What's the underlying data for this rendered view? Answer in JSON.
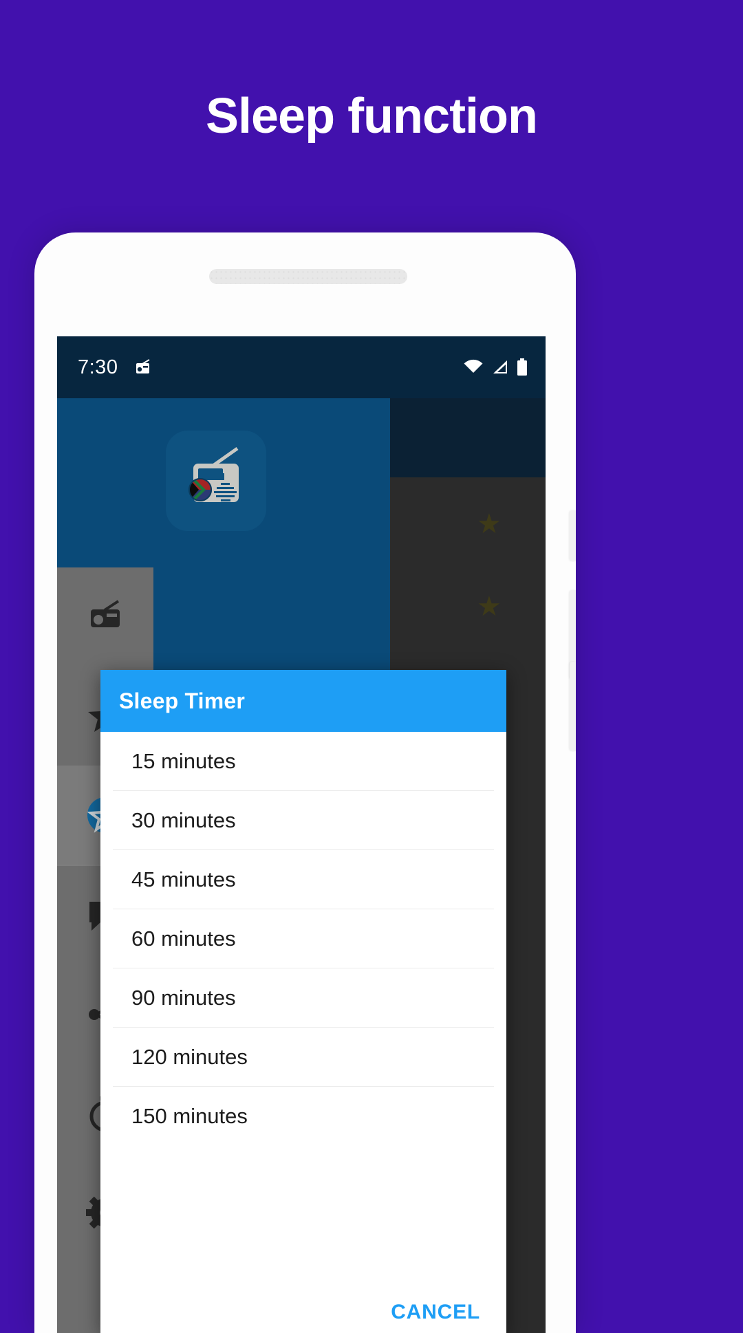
{
  "promo": {
    "title": "Sleep function",
    "background_color": "#4211ad"
  },
  "phone": {
    "status_bar": {
      "time": "7:30",
      "left_icons": [
        "radio-notification-icon"
      ],
      "right_icons": [
        "wifi-icon",
        "signal-icon",
        "battery-icon"
      ],
      "background_color": "#07263f"
    },
    "app": {
      "artwork_icon": "radio-south-africa-icon",
      "drawer_items": [
        {
          "icon": "radio-icon",
          "selected": false
        },
        {
          "icon": "star-icon",
          "selected": false
        },
        {
          "icon": "star-circle-icon",
          "selected": true
        },
        {
          "icon": "feedback-icon",
          "selected": false
        },
        {
          "icon": "share-icon",
          "selected": false
        },
        {
          "icon": "timer-icon",
          "selected": false
        },
        {
          "icon": "settings-icon",
          "selected": false
        }
      ]
    },
    "dialog": {
      "title": "Sleep Timer",
      "header_color": "#1e9ef5",
      "options": [
        {
          "label": "15 minutes"
        },
        {
          "label": "30 minutes"
        },
        {
          "label": "45 minutes"
        },
        {
          "label": "60 minutes"
        },
        {
          "label": "90 minutes"
        },
        {
          "label": "120 minutes"
        },
        {
          "label": "150 minutes"
        }
      ],
      "cancel_label": "CANCEL",
      "cancel_color": "#1e9ef5"
    }
  }
}
